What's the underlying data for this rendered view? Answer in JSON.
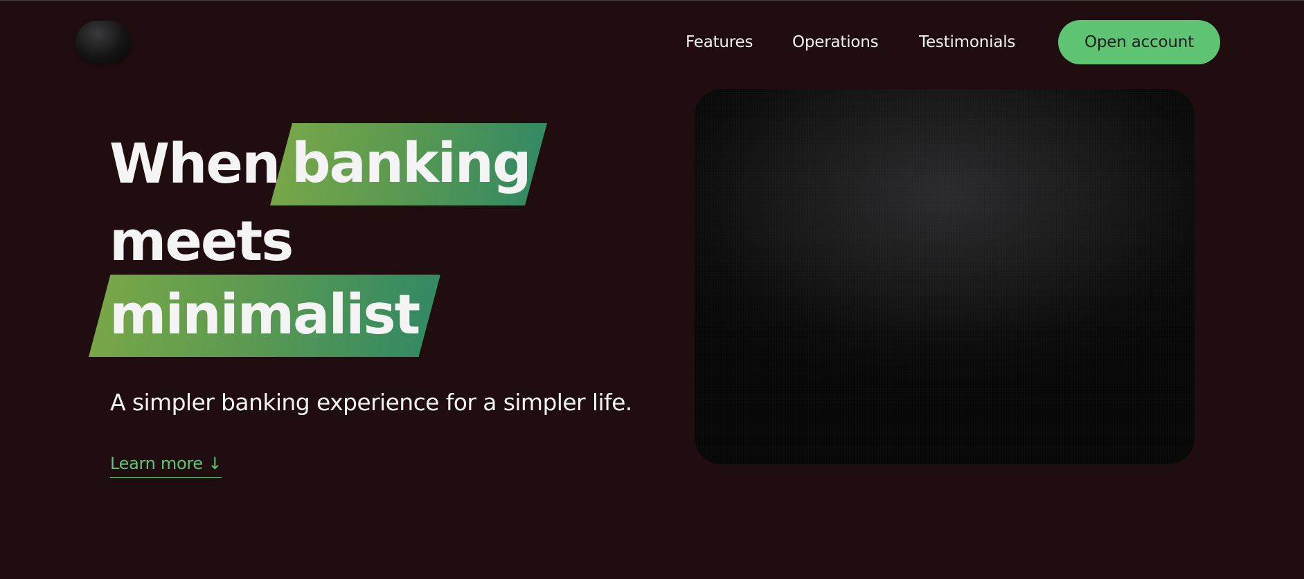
{
  "nav": {
    "links": [
      {
        "label": "Features"
      },
      {
        "label": "Operations"
      },
      {
        "label": "Testimonials"
      }
    ],
    "cta_label": "Open account"
  },
  "hero": {
    "headline": {
      "word_when": "When",
      "word_banking": "banking",
      "word_meets": "meets",
      "word_minimalist": "minimalist"
    },
    "subtitle": "A simpler banking experience for a simpler life.",
    "learn_more": "Learn more ↓"
  },
  "colors": {
    "background": "#200d10",
    "accent_green": "#5ec474",
    "highlight_gradient_start": "#7aa847",
    "highlight_gradient_end": "#2f8865",
    "text": "#f4f4f4"
  },
  "icons": {
    "logo": "round-dark-logo"
  }
}
